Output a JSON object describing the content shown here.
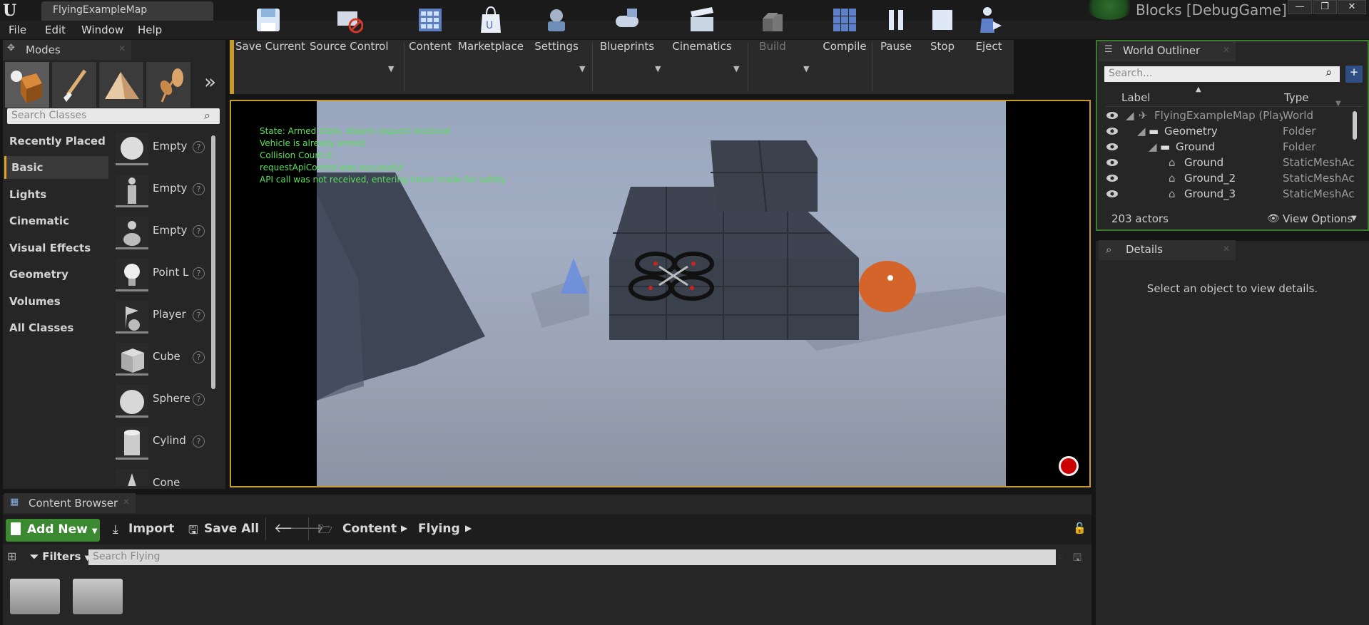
{
  "titlebar": {
    "doc_tab": "FlyingExampleMap",
    "project": "Blocks [DebugGame]",
    "min": "—",
    "max": "❐",
    "close": "✕"
  },
  "menu": [
    "File",
    "Edit",
    "Window",
    "Help"
  ],
  "modes": {
    "tab": "Modes",
    "search_placeholder": "Search Classes",
    "categories": [
      "Recently Placed",
      "Basic",
      "Lights",
      "Cinematic",
      "Visual Effects",
      "Geometry",
      "Volumes",
      "All Classes"
    ],
    "selected_category": "Basic",
    "items": [
      "Empty",
      "Empty",
      "Empty",
      "Point L",
      "Player",
      "Cube",
      "Sphere",
      "Cylind",
      "Cone"
    ]
  },
  "toolbar": [
    "Save Current",
    "Source Control",
    "Content",
    "Marketplace",
    "Settings",
    "Blueprints",
    "Cinematics",
    "Build",
    "Compile",
    "Pause",
    "Stop",
    "Eject"
  ],
  "viewport": {
    "messages": [
      "State: Armed state, disarm request received",
      "Vehicle is already armed",
      "Collision Count:0",
      "requestApiControl was successful",
      "API call was not received, entering hover mode for safety"
    ]
  },
  "outliner": {
    "tab": "World Outliner",
    "search_placeholder": "Search...",
    "col_label": "Label",
    "col_type": "Type",
    "rows": [
      {
        "label": "FlyingExampleMap (Play In",
        "type": "World"
      },
      {
        "label": "Geometry",
        "type": "Folder"
      },
      {
        "label": "Ground",
        "type": "Folder"
      },
      {
        "label": "Ground",
        "type": "StaticMeshAc"
      },
      {
        "label": "Ground_2",
        "type": "StaticMeshAc"
      },
      {
        "label": "Ground_3",
        "type": "StaticMeshAc"
      }
    ],
    "actor_count": "203 actors",
    "view_options": "View Options"
  },
  "details": {
    "tab": "Details",
    "empty_message": "Select an object to view details."
  },
  "content_browser": {
    "tab": "Content Browser",
    "add_new": "Add New",
    "import": "Import",
    "save_all": "Save All",
    "path": [
      "Content",
      "Flying"
    ],
    "filters": "Filters",
    "search_placeholder": "Search Flying"
  },
  "colors": {
    "accent": "#c69b2e",
    "overlay_text": "#59e05a",
    "add_new": "#3b8a32",
    "outliner_border": "#3a7d2d"
  }
}
